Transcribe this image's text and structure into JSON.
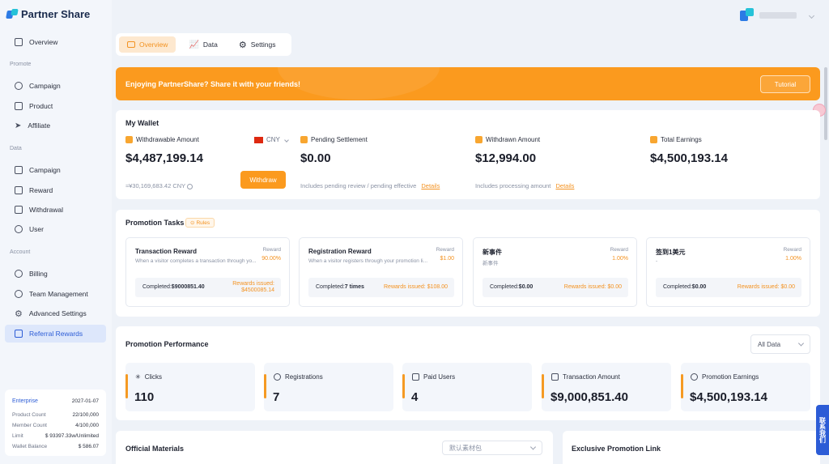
{
  "app": {
    "name": "Partner Share"
  },
  "sidebar": {
    "overview": "Overview",
    "sections": {
      "promote": "Promote",
      "data": "Data",
      "account": "Account"
    },
    "promote_items": [
      "Campaign",
      "Product",
      "Affiliate"
    ],
    "data_items": [
      "Campaign",
      "Reward",
      "Withdrawal",
      "User"
    ],
    "account_items": [
      "Billing",
      "Team Management",
      "Advanced Settings",
      "Referral Rewards"
    ],
    "active_item": "Referral Rewards"
  },
  "enterprise": {
    "plan": "Enterprise",
    "expiry": "2027-01-07",
    "rows": [
      {
        "label": "Product Count",
        "value": "22/100,000"
      },
      {
        "label": "Member Count",
        "value": "4/100,000"
      },
      {
        "label": "Limit",
        "value": "$ 93397.33w/Unlimited"
      },
      {
        "label": "Wallet Balance",
        "value": "$ 586.07"
      }
    ]
  },
  "tabs": [
    "Overview",
    "Data",
    "Settings"
  ],
  "active_tab": "Overview",
  "banner": {
    "text": "Enjoying PartnerShare? Share it with your friends!",
    "button": "Tutorial"
  },
  "wallet": {
    "title": "My Wallet",
    "withdrawable": {
      "label": "Withdrawable Amount",
      "value": "$4,487,199.14",
      "currency": "CNY",
      "converted": "≈¥30,169,683.42  CNY",
      "button": "Withdraw"
    },
    "pending": {
      "label": "Pending Settlement",
      "value": "$0.00",
      "note": "Includes pending review / pending effective",
      "link": "Details"
    },
    "withdrawn": {
      "label": "Withdrawn Amount",
      "value": "$12,994.00",
      "note": "Includes processing amount",
      "link": "Details"
    },
    "total": {
      "label": "Total Earnings",
      "value": "$4,500,193.14"
    }
  },
  "tasks": {
    "title": "Promotion Tasks",
    "rules": "Rules",
    "reward_label": "Reward",
    "completed_label": "Completed:",
    "items": [
      {
        "name": "Transaction Reward",
        "desc": "When a visitor completes a transaction through yo...",
        "reward": "90.00%",
        "completed": "$9000851.40",
        "issued": "Rewards issued: $4500085.14"
      },
      {
        "name": "Registration Reward",
        "desc": "When a visitor registers through your promotion li...",
        "reward": "$1.00",
        "completed": "7 times",
        "issued": "Rewards issued: $108.00"
      },
      {
        "name": "新事件",
        "desc": "新事件",
        "reward": "1.00%",
        "completed": "$0.00",
        "issued": "Rewards issued: $0.00"
      },
      {
        "name": "签到1美元",
        "desc": "-",
        "reward": "1.00%",
        "completed": "$0.00",
        "issued": "Rewards issued: $0.00"
      }
    ]
  },
  "performance": {
    "title": "Promotion Performance",
    "filter": "All Data",
    "metrics": [
      {
        "label": "Clicks",
        "value": "110"
      },
      {
        "label": "Registrations",
        "value": "7"
      },
      {
        "label": "Paid Users",
        "value": "4"
      },
      {
        "label": "Transaction Amount",
        "value": "$9,000,851.40"
      },
      {
        "label": "Promotion Earnings",
        "value": "$4,500,193.14"
      }
    ]
  },
  "materials": {
    "title": "Official Materials",
    "select": "默认素材包"
  },
  "promo_link": {
    "title": "Exclusive Promotion Link"
  },
  "side_tab": "联系我们",
  "colors": {
    "accent": "#fb9a1e",
    "brand": "#2c5cd6"
  }
}
